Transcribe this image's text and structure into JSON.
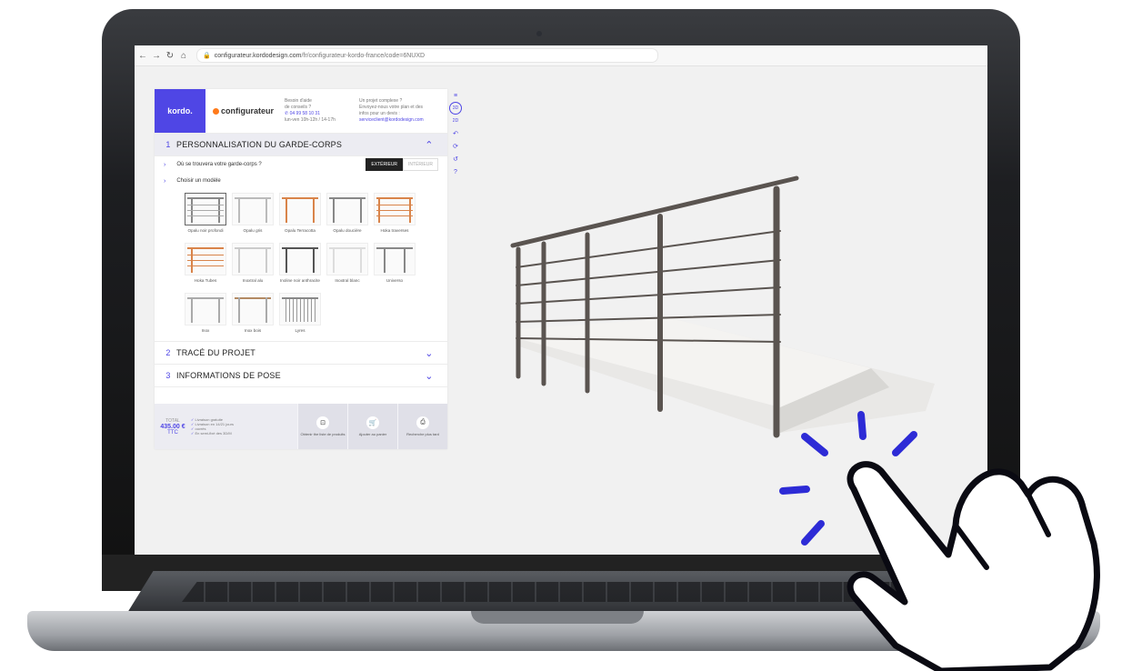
{
  "browser": {
    "url_host": "configurateur.kordodesign.com",
    "url_path": "/fr/configurateur-kordo-france/code=6NUXD"
  },
  "header": {
    "logo_kordo": "kordo.",
    "logo_config": "configurateur",
    "help_lines": [
      "Besoin d'aide",
      "de conseils ?"
    ],
    "help_phone": "04 99 58 10 31",
    "help_hours": "lun-ven 10h-12h / 14-17h",
    "project_lines": [
      "Un projet complexe ?",
      "Envoyez-nous votre plan et des",
      "infos pour un devis :"
    ],
    "project_email": "serviceclient@kordodesign.com"
  },
  "sections": [
    {
      "num": "1",
      "title": "PERSONNALISATION DU GARDE-CORPS",
      "chev": "⌃"
    },
    {
      "num": "2",
      "title": "TRACÉ DU PROJET",
      "chev": "⌄"
    },
    {
      "num": "3",
      "title": "INFORMATIONS DE POSE",
      "chev": "⌄"
    }
  ],
  "location": {
    "question": "Où se trouvera votre garde-corps ?",
    "option_ext": "EXTÉRIEUR",
    "option_int": "INTÉRIEUR"
  },
  "model_prompt": "Choisir un modèle",
  "models": [
    "Opalu noir profondi",
    "Opalu gris",
    "Opalu Terracotta",
    "Opalu doucière",
    "Hoka traverses",
    "Hoka Tubes",
    "Inoxtral alu",
    "Inoline noir anthracite",
    "Inoxtral blanc",
    "Universo",
    "Inox",
    "Inox bois",
    "Lyres"
  ],
  "footer": {
    "total_label": "TOTAL",
    "price": "435.00 €",
    "ttc": "TTC",
    "perks": [
      "Livraison gratuite",
      "Livraison en 14/21 jours",
      "ouvrés",
      "En semi-fixé des 3D/M"
    ],
    "actions": [
      {
        "icon": "⊡",
        "label": "Obtenir the liste de produits"
      },
      {
        "icon": "🛒",
        "label": "Ajouter au panier"
      },
      {
        "icon": "⎙",
        "label": "Recherche plus tard"
      }
    ]
  },
  "tools": [
    "≡",
    "3D",
    "2D",
    "↶",
    "⟳",
    "↺",
    "?"
  ]
}
